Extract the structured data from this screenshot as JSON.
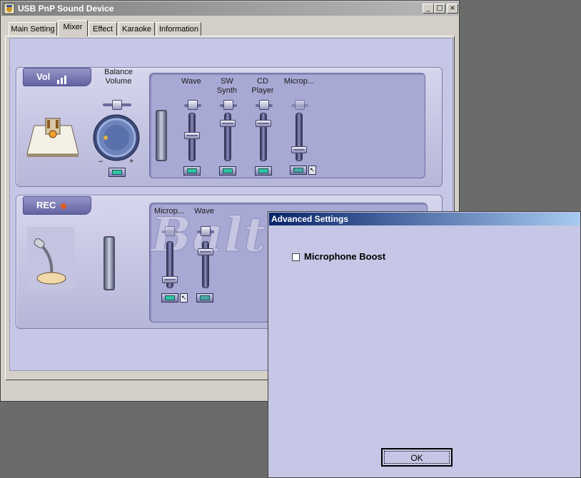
{
  "window": {
    "title": "USB PnP Sound Device",
    "controls": {
      "minimize": "_",
      "maximize": "□",
      "close": "×"
    }
  },
  "tabs": [
    {
      "label": "Main Setting"
    },
    {
      "label": "Mixer",
      "active": true
    },
    {
      "label": "Effect"
    },
    {
      "label": "Karaoke"
    },
    {
      "label": "Information"
    }
  ],
  "volume_group": {
    "ribbon_label": "Vol",
    "balance_label": "Balance\nVolume",
    "knob_minus": "–",
    "knob_plus": "+",
    "channels": [
      {
        "label": "Wave",
        "level": 0.55,
        "muted": false
      },
      {
        "label": "SW\nSynth",
        "level": 0.85,
        "muted": false
      },
      {
        "label": "CD\nPlayer",
        "level": 0.85,
        "muted": false
      },
      {
        "label": "Microp...",
        "level": 0.2,
        "muted": true,
        "advanced": "↖"
      }
    ]
  },
  "rec_group": {
    "ribbon_label": "REC",
    "channels": [
      {
        "label": "Microp...",
        "level": 0.1,
        "selected": true,
        "advanced": "↖"
      },
      {
        "label": "Wave",
        "level": 0.85,
        "selected": false
      }
    ]
  },
  "watermark": "Baltrade",
  "dialog": {
    "title": "Advanced Settings",
    "checkbox_label": "Microphone Boost",
    "checkbox_checked": false,
    "ok_label": "OK"
  },
  "colors": {
    "panel": "#c6c6e6",
    "dialog_title": "#0a246a",
    "accent_teal": "#2fc4a4"
  }
}
